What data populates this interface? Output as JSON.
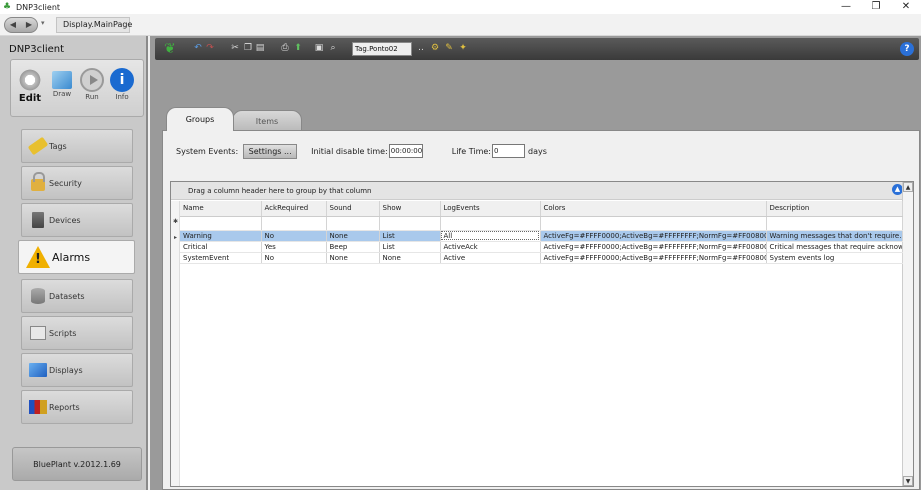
{
  "window": {
    "title": "DNP3client",
    "minimize": "—",
    "maximize": "❐",
    "close": "✕"
  },
  "nav": {
    "back": "◀",
    "forward": "▶",
    "dropdown": "▾",
    "address": "Display.MainPage"
  },
  "sidebar": {
    "title": "DNP3client",
    "modes": [
      {
        "label": "Edit",
        "icon": "gear-icon",
        "active": true
      },
      {
        "label": "Draw",
        "icon": "draw-icon",
        "active": false
      },
      {
        "label": "Run",
        "icon": "play-icon",
        "active": false
      },
      {
        "label": "Info",
        "icon": "info-icon",
        "active": false
      }
    ],
    "items": [
      {
        "label": "Tags",
        "icon": "tag-icon"
      },
      {
        "label": "Security",
        "icon": "lock-icon"
      },
      {
        "label": "Devices",
        "icon": "device-icon"
      },
      {
        "label": "Alarms",
        "icon": "warning-icon",
        "active": true
      },
      {
        "label": "Datasets",
        "icon": "database-icon"
      },
      {
        "label": "Scripts",
        "icon": "script-icon"
      },
      {
        "label": "Displays",
        "icon": "display-icon"
      },
      {
        "label": "Reports",
        "icon": "report-icon"
      }
    ],
    "version": "BluePlant  v.2012.1.69"
  },
  "toolbar": {
    "tag_input": "Tag.Ponto02",
    "tag_browse": "..",
    "help": "?"
  },
  "tabs": {
    "groups": "Groups",
    "items": "Items"
  },
  "settings": {
    "system_events_label": "System Events:",
    "settings_button": "Settings ...",
    "initial_disable_label": "Initial disable time:",
    "initial_disable_value": "00:00:00",
    "life_time_label": "Life Time:",
    "life_time_value": "0",
    "days_label": "days"
  },
  "grid": {
    "group_hint": "Drag a column header here to group by that column",
    "new_row_marker": "✱",
    "current_row_marker": "▸",
    "columns": [
      "Name",
      "AckRequired",
      "Sound",
      "Show",
      "LogEvents",
      "Colors",
      "Description"
    ],
    "rows": [
      [
        "Warning",
        "No",
        "None",
        "List",
        "All",
        "ActiveFg=#FFFF0000;ActiveBg=#FFFFFFFF;NormFg=#FF008000;No...",
        "Warning messages that don't require..."
      ],
      [
        "Critical",
        "Yes",
        "Beep",
        "List",
        "ActiveAck",
        "ActiveFg=#FFFF0000;ActiveBg=#FFFFFFFF;NormFg=#FF008000;No...",
        "Critical messages that require acknow..."
      ],
      [
        "SystemEvent",
        "No",
        "None",
        "None",
        "Active",
        "ActiveFg=#FFFF0000;ActiveBg=#FFFFFFFF;NormFg=#FF008000;No...",
        "System events log"
      ]
    ]
  },
  "colors": {
    "selected_row": "#a9c9ec",
    "toolbar_bg": "#3a3a3a",
    "sidebar_bg": "#c9c9c9",
    "alarm_icon": "#f0b000"
  }
}
